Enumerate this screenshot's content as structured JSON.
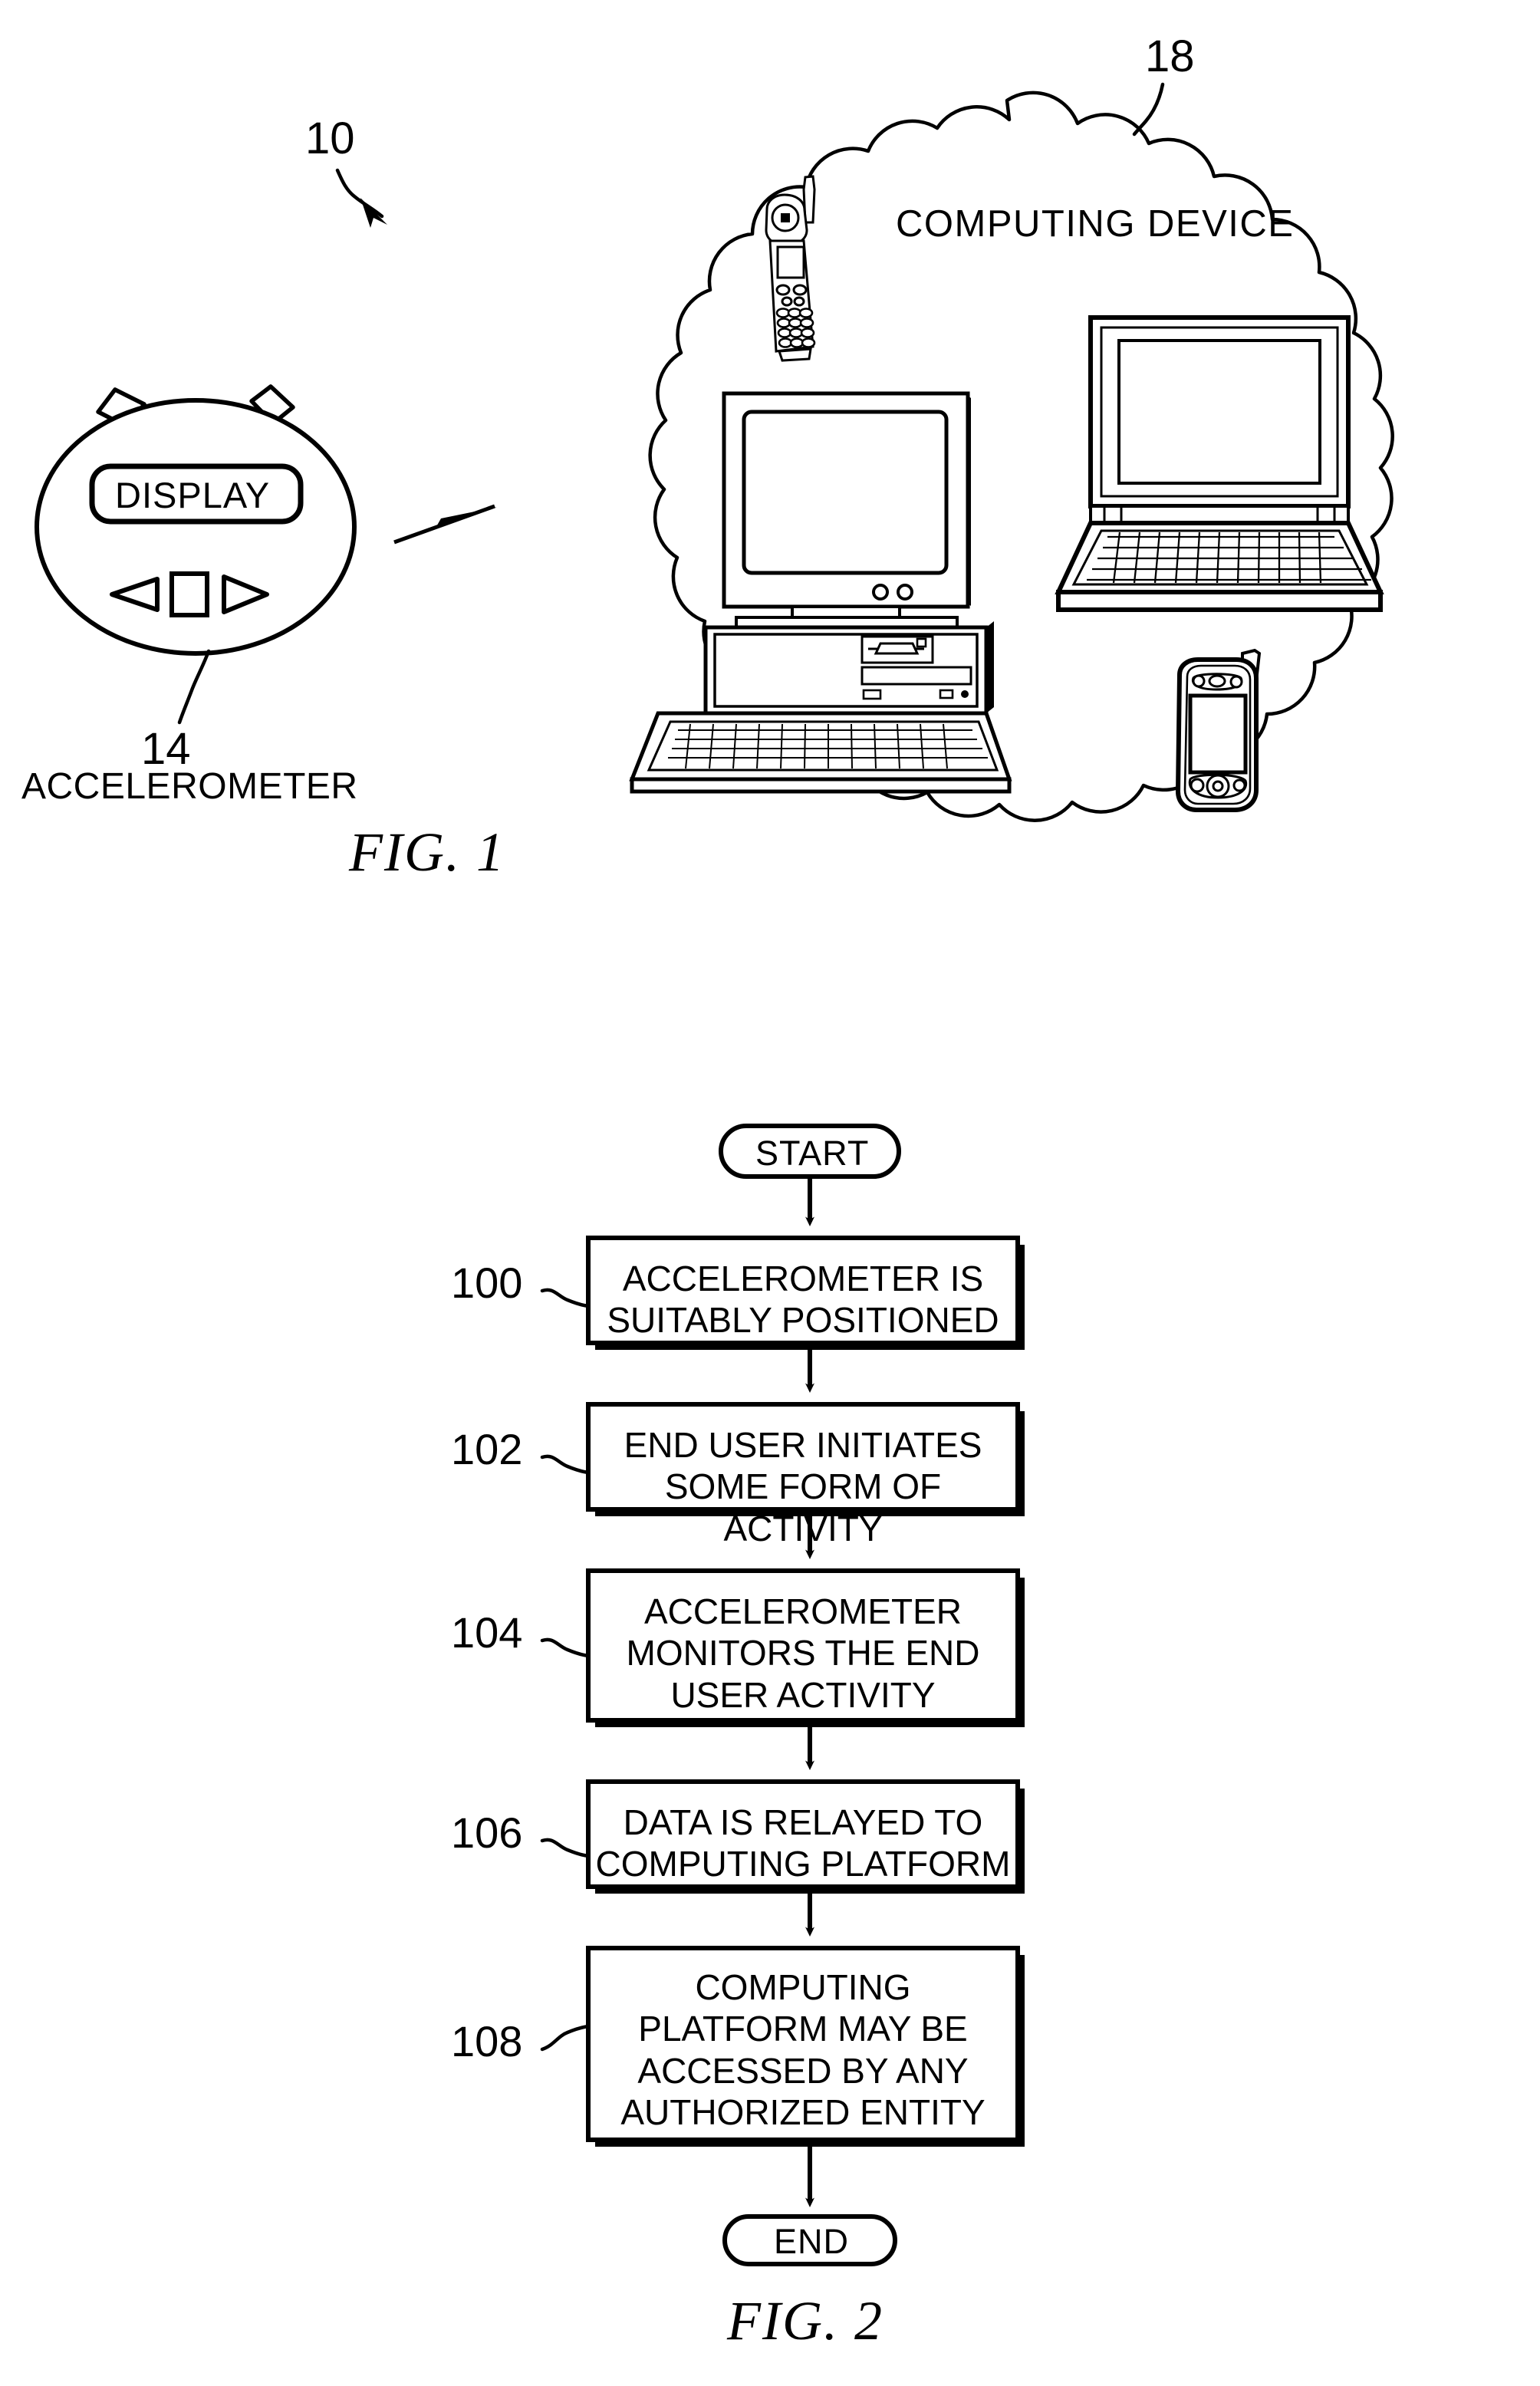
{
  "document": {
    "type": "patent-drawing-sheet",
    "figures": [
      "FIG. 1",
      "FIG. 2"
    ]
  },
  "fig1": {
    "caption": "FIG. 1",
    "system_ref": "10",
    "cloud": {
      "ref": "18",
      "label": "COMPUTING DEVICE",
      "devices": [
        {
          "name": "cell-phone",
          "label": "cell phone"
        },
        {
          "name": "desktop-computer",
          "label": "desktop computer"
        },
        {
          "name": "laptop-computer",
          "label": "laptop computer"
        },
        {
          "name": "pda-device",
          "label": "personal digital assistant"
        }
      ]
    },
    "accelerometer": {
      "ref": "14",
      "caption": "ACCELEROMETER",
      "display_label": "DISPLAY",
      "buttons": [
        "left-arrow",
        "square",
        "right-arrow"
      ]
    }
  },
  "fig2": {
    "caption": "FIG. 2",
    "start_label": "START",
    "end_label": "END",
    "steps": [
      {
        "ref": "100",
        "text": "ACCELEROMETER IS\nSUITABLY POSITIONED",
        "lines": [
          "ACCELEROMETER IS",
          "SUITABLY POSITIONED"
        ]
      },
      {
        "ref": "102",
        "text": "END USER INITIATES\nSOME FORM OF ACTIVITY",
        "lines": [
          "END USER INITIATES",
          "SOME FORM OF ACTIVITY"
        ]
      },
      {
        "ref": "104",
        "text": "ACCELEROMETER\nMONITORS THE END\nUSER ACTIVITY",
        "lines": [
          "ACCELEROMETER",
          "MONITORS THE END",
          "USER ACTIVITY"
        ]
      },
      {
        "ref": "106",
        "text": "DATA IS RELAYED TO\nCOMPUTING PLATFORM",
        "lines": [
          "DATA IS RELAYED TO",
          "COMPUTING PLATFORM"
        ]
      },
      {
        "ref": "108",
        "text": "COMPUTING\nPLATFORM MAY BE\nACCESSED BY ANY\nAUTHORIZED ENTITY",
        "lines": [
          "COMPUTING",
          "PLATFORM MAY BE",
          "ACCESSED BY ANY",
          "AUTHORIZED ENTITY"
        ]
      }
    ]
  },
  "colors": {
    "ink": "#000000",
    "paper": "#ffffff"
  }
}
